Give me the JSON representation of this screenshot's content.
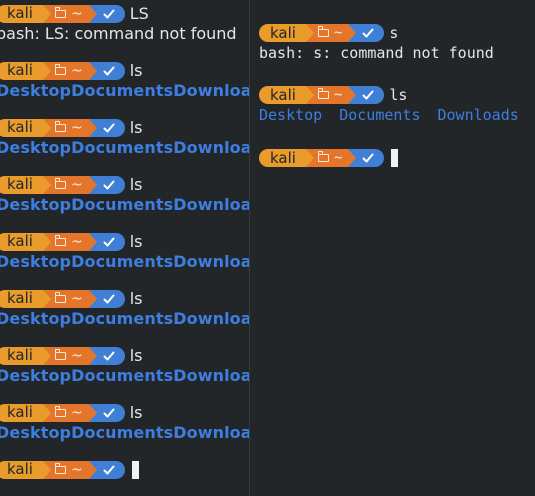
{
  "prompt": {
    "user": "kali",
    "dir": "~",
    "icons": [
      "folder-icon",
      "check-icon"
    ],
    "colors": {
      "user_bg": "#e99c2c",
      "dir_bg": "#e4762c",
      "status_bg": "#3f7fd5",
      "dir_text": "#3d7ee0",
      "terminal_bg": "#222628"
    }
  },
  "left_pane": {
    "first_command": "LS",
    "first_output": "bash: LS: command not found",
    "repeat_command": "ls",
    "repeat_output": "DesktopDocumentsDownloa"
  },
  "right_pane": {
    "first_command": "s",
    "first_output": "bash: s: command not found",
    "second_command": "ls",
    "listing": [
      "Desktop",
      "Documents",
      "Downloads"
    ]
  }
}
